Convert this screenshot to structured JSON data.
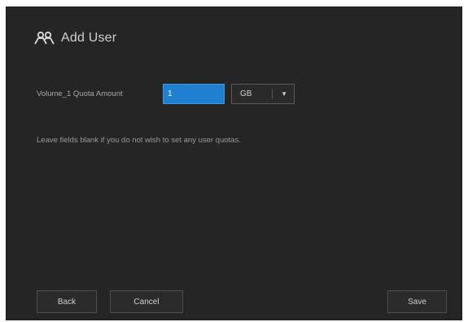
{
  "dialog": {
    "title": "Add User",
    "title_icon": "users-icon"
  },
  "quota": {
    "label": "Volume_1 Quota Amount",
    "input_value": "1",
    "unit_selected": "GB"
  },
  "hint": "Leave fields blank if you do not wish to set any user quotas.",
  "buttons": {
    "back": "Back",
    "cancel": "Cancel",
    "save": "Save"
  },
  "colors": {
    "dialog_bg": "#252525",
    "input_accent": "#1f7fd1",
    "text": "#d0d0d0"
  }
}
